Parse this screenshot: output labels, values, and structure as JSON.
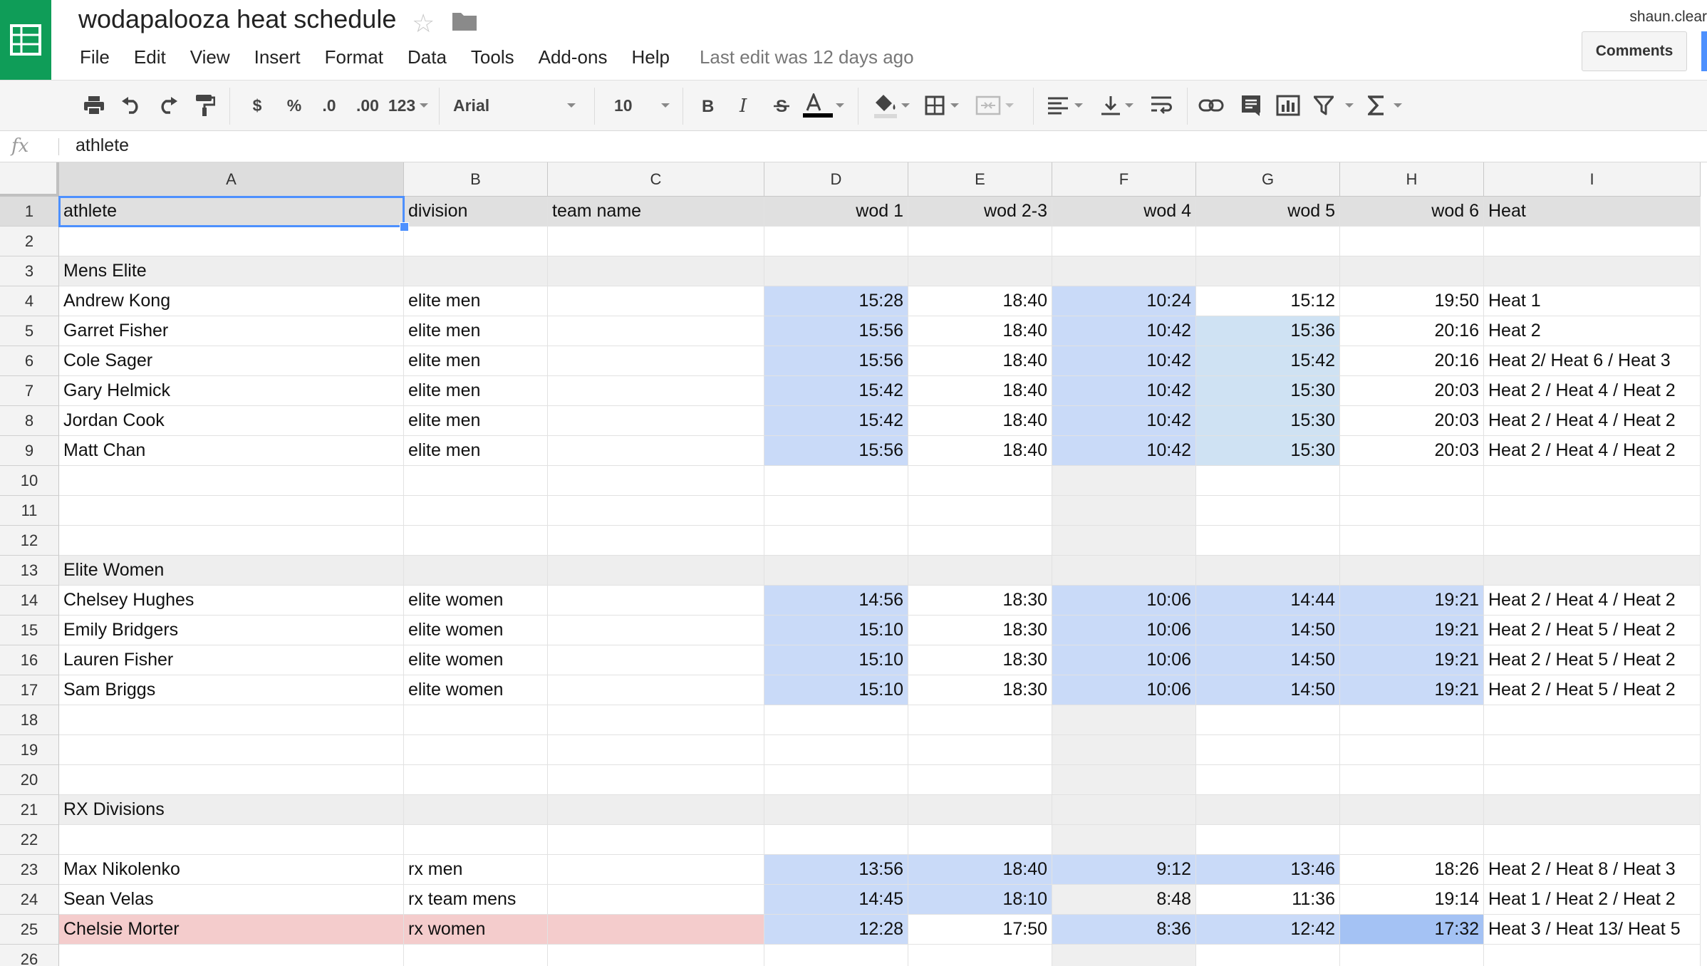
{
  "header": {
    "title": "wodapalooza heat schedule",
    "menu": [
      "File",
      "Edit",
      "View",
      "Insert",
      "Format",
      "Data",
      "Tools",
      "Add-ons",
      "Help"
    ],
    "last_edit": "Last edit was 12 days ago",
    "user": "shaun.clear",
    "comments_label": "Comments"
  },
  "toolbar": {
    "currency": "$",
    "percent": "%",
    "decrease_decimals": ".0",
    "increase_decimals": ".00",
    "more_formats": "123",
    "font": "Arial",
    "font_size": "10"
  },
  "formula_bar": {
    "fx": "fx",
    "value": "athlete"
  },
  "grid": {
    "columns": [
      "A",
      "B",
      "C",
      "D",
      "E",
      "F",
      "G",
      "H",
      "I"
    ],
    "selected_cell": "A1",
    "colors": {
      "header_row": "#e0e0e0",
      "section_row": "#eeeeee",
      "time_blue": "#c9daf8",
      "time_light_blue": "#cfe2f3",
      "time_dark_blue": "#a4c2f4",
      "gray_cell": "#efefef",
      "highlight_row": "#f4cccc"
    },
    "rows": [
      {
        "n": "1",
        "kind": "header",
        "cells": [
          "athlete",
          "division",
          "team name",
          "wod 1",
          "wod 2-3",
          "wod 4",
          "wod 5",
          "wod 6",
          "Heat"
        ]
      },
      {
        "n": "2",
        "kind": "blank",
        "cells": [
          "",
          "",
          "",
          "",
          "",
          "",
          "",
          "",
          ""
        ]
      },
      {
        "n": "3",
        "kind": "section",
        "cells": [
          "Mens Elite",
          "",
          "",
          "",
          "",
          "",
          "",
          "",
          ""
        ]
      },
      {
        "n": "4",
        "kind": "data",
        "cells": [
          "Andrew Kong",
          "elite men",
          "",
          "15:28",
          "18:40",
          "10:24",
          "15:12",
          "19:50",
          "Heat 1"
        ],
        "fills": [
          "",
          "",
          "",
          "blue",
          "",
          "blue",
          "",
          "",
          ""
        ]
      },
      {
        "n": "5",
        "kind": "data",
        "cells": [
          "Garret Fisher",
          "elite men",
          "",
          "15:56",
          "18:40",
          "10:42",
          "15:36",
          "20:16",
          "Heat 2"
        ],
        "fills": [
          "",
          "",
          "",
          "blue",
          "",
          "blue",
          "lightblue",
          "",
          ""
        ]
      },
      {
        "n": "6",
        "kind": "data",
        "cells": [
          "Cole Sager",
          "elite men",
          "",
          "15:56",
          "18:40",
          "10:42",
          "15:42",
          "20:16",
          "Heat 2/ Heat 6 / Heat 3"
        ],
        "fills": [
          "",
          "",
          "",
          "blue",
          "",
          "blue",
          "lightblue",
          "",
          ""
        ]
      },
      {
        "n": "7",
        "kind": "data",
        "cells": [
          "Gary Helmick",
          "elite men",
          "",
          "15:42",
          "18:40",
          "10:42",
          "15:30",
          "20:03",
          "Heat 2 / Heat 4 / Heat 2"
        ],
        "fills": [
          "",
          "",
          "",
          "blue",
          "",
          "blue",
          "lightblue",
          "",
          ""
        ]
      },
      {
        "n": "8",
        "kind": "data",
        "cells": [
          "Jordan Cook",
          "elite men",
          "",
          "15:42",
          "18:40",
          "10:42",
          "15:30",
          "20:03",
          "Heat 2 / Heat 4 / Heat 2"
        ],
        "fills": [
          "",
          "",
          "",
          "blue",
          "",
          "blue",
          "lightblue",
          "",
          ""
        ]
      },
      {
        "n": "9",
        "kind": "data",
        "cells": [
          "Matt Chan",
          "elite men",
          "",
          "15:56",
          "18:40",
          "10:42",
          "15:30",
          "20:03",
          "Heat 2 / Heat 4 / Heat 2"
        ],
        "fills": [
          "",
          "",
          "",
          "blue",
          "",
          "blue",
          "lightblue",
          "",
          ""
        ]
      },
      {
        "n": "10",
        "kind": "blank",
        "cells": [
          "",
          "",
          "",
          "",
          "",
          "",
          "",
          "",
          ""
        ],
        "fills": [
          "",
          "",
          "",
          "",
          "",
          "gray",
          "",
          "",
          ""
        ]
      },
      {
        "n": "11",
        "kind": "blank",
        "cells": [
          "",
          "",
          "",
          "",
          "",
          "",
          "",
          "",
          ""
        ],
        "fills": [
          "",
          "",
          "",
          "",
          "",
          "gray",
          "",
          "",
          ""
        ]
      },
      {
        "n": "12",
        "kind": "blank",
        "cells": [
          "",
          "",
          "",
          "",
          "",
          "",
          "",
          "",
          ""
        ],
        "fills": [
          "",
          "",
          "",
          "",
          "",
          "gray",
          "",
          "",
          ""
        ]
      },
      {
        "n": "13",
        "kind": "section",
        "cells": [
          "Elite Women",
          "",
          "",
          "",
          "",
          "",
          "",
          "",
          ""
        ]
      },
      {
        "n": "14",
        "kind": "data",
        "cells": [
          "Chelsey Hughes",
          "elite women",
          "",
          "14:56",
          "18:30",
          "10:06",
          "14:44",
          "19:21",
          "Heat 2 / Heat 4 / Heat 2"
        ],
        "fills": [
          "",
          "",
          "",
          "blue",
          "",
          "blue",
          "blue",
          "blue",
          ""
        ]
      },
      {
        "n": "15",
        "kind": "data",
        "cells": [
          "Emily Bridgers",
          "elite women",
          "",
          "15:10",
          "18:30",
          "10:06",
          "14:50",
          "19:21",
          "Heat 2 / Heat 5 / Heat 2"
        ],
        "fills": [
          "",
          "",
          "",
          "blue",
          "",
          "blue",
          "blue",
          "blue",
          ""
        ]
      },
      {
        "n": "16",
        "kind": "data",
        "cells": [
          "Lauren Fisher",
          "elite women",
          "",
          "15:10",
          "18:30",
          "10:06",
          "14:50",
          "19:21",
          "Heat 2 / Heat 5 / Heat 2"
        ],
        "fills": [
          "",
          "",
          "",
          "blue",
          "",
          "blue",
          "blue",
          "blue",
          ""
        ]
      },
      {
        "n": "17",
        "kind": "data",
        "cells": [
          "Sam Briggs",
          "elite women",
          "",
          "15:10",
          "18:30",
          "10:06",
          "14:50",
          "19:21",
          "Heat 2 / Heat 5 / Heat 2"
        ],
        "fills": [
          "",
          "",
          "",
          "blue",
          "",
          "blue",
          "blue",
          "blue",
          ""
        ]
      },
      {
        "n": "18",
        "kind": "blank",
        "cells": [
          "",
          "",
          "",
          "",
          "",
          "",
          "",
          "",
          ""
        ],
        "fills": [
          "",
          "",
          "",
          "",
          "",
          "gray",
          "",
          "",
          ""
        ]
      },
      {
        "n": "19",
        "kind": "blank",
        "cells": [
          "",
          "",
          "",
          "",
          "",
          "",
          "",
          "",
          ""
        ],
        "fills": [
          "",
          "",
          "",
          "",
          "",
          "gray",
          "",
          "",
          ""
        ]
      },
      {
        "n": "20",
        "kind": "blank",
        "cells": [
          "",
          "",
          "",
          "",
          "",
          "",
          "",
          "",
          ""
        ],
        "fills": [
          "",
          "",
          "",
          "",
          "",
          "gray",
          "",
          "",
          ""
        ]
      },
      {
        "n": "21",
        "kind": "section",
        "cells": [
          "RX Divisions",
          "",
          "",
          "",
          "",
          "",
          "",
          "",
          ""
        ]
      },
      {
        "n": "22",
        "kind": "blank",
        "cells": [
          "",
          "",
          "",
          "",
          "",
          "",
          "",
          "",
          ""
        ],
        "fills": [
          "",
          "",
          "",
          "",
          "",
          "gray",
          "",
          "",
          ""
        ]
      },
      {
        "n": "23",
        "kind": "data",
        "cells": [
          "Max Nikolenko",
          "rx men",
          "",
          "13:56",
          "18:40",
          "9:12",
          "13:46",
          "18:26",
          "Heat 2 / Heat 8 / Heat 3"
        ],
        "fills": [
          "",
          "",
          "",
          "blue",
          "blue",
          "blue",
          "blue",
          "",
          ""
        ]
      },
      {
        "n": "24",
        "kind": "data",
        "cells": [
          "Sean Velas",
          "rx team mens",
          "",
          "14:45",
          "18:10",
          "8:48",
          "11:36",
          "19:14",
          "Heat 1 / Heat 2 / Heat 2"
        ],
        "fills": [
          "",
          "",
          "",
          "blue",
          "blue",
          "gray",
          "",
          "",
          ""
        ]
      },
      {
        "n": "25",
        "kind": "data",
        "cells": [
          "Chelsie Morter",
          "rx women",
          "",
          "12:28",
          "17:50",
          "8:36",
          "12:42",
          "17:32",
          "Heat 3  / Heat 13/ Heat 5"
        ],
        "fills": [
          "red",
          "red",
          "red",
          "blue",
          "",
          "blue",
          "blue",
          "darkblue",
          ""
        ]
      },
      {
        "n": "26",
        "kind": "blank",
        "cells": [
          "",
          "",
          "",
          "",
          "",
          "",
          "",
          "",
          ""
        ],
        "fills": [
          "",
          "",
          "",
          "",
          "",
          "gray",
          "",
          "",
          ""
        ]
      }
    ]
  }
}
